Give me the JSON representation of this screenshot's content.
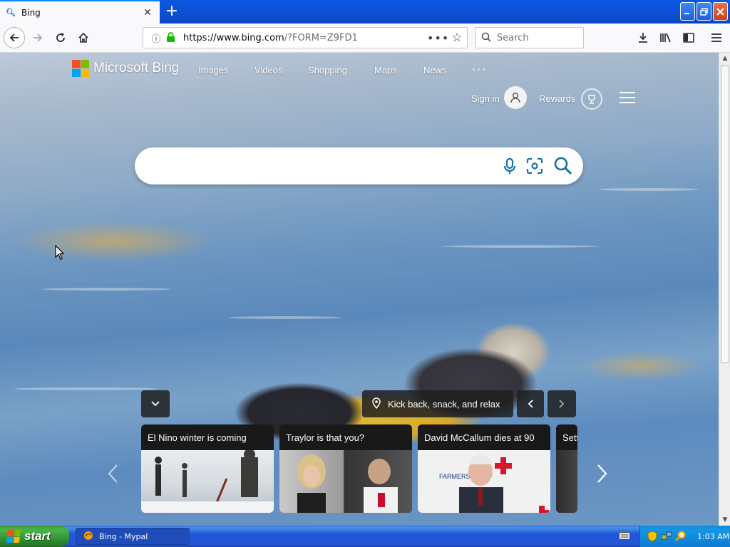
{
  "browser": {
    "tab_title": "Bing",
    "url_host": "https://www.bing.com",
    "url_rest": "/?FORM=Z9FD1",
    "search_placeholder": "Search"
  },
  "bing": {
    "brand": "Microsoft Bing",
    "nav": [
      "Images",
      "Videos",
      "Shopping",
      "Maps",
      "News"
    ],
    "more": "···",
    "signin": "Sign in",
    "rewards": "Rewards",
    "image_caption": "Kick back, snack, and relax",
    "cards": [
      {
        "headline": "El Nino winter is coming"
      },
      {
        "headline": "Traylor is that you?"
      },
      {
        "headline": "David McCallum dies at 90"
      },
      {
        "headline": "Sett"
      }
    ]
  },
  "taskbar": {
    "start_label": "start",
    "task_label": "Bing - Mypal",
    "clock": "1:03 AM"
  },
  "colors": {
    "ms_red": "#f25022",
    "ms_green": "#7fba00",
    "ms_blue": "#00a4ef",
    "ms_yellow": "#ffb900",
    "bing_teal": "#17739c"
  }
}
